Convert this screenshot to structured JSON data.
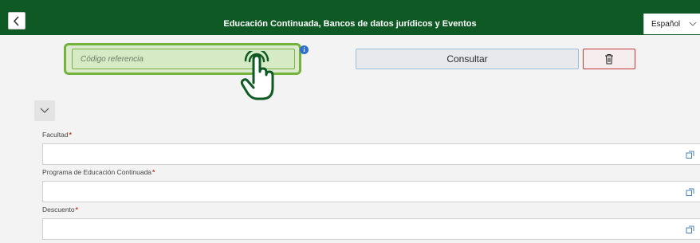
{
  "header": {
    "title": "Educación Continuada, Bancos de datos jurídicos y Eventos",
    "language": "Español",
    "background_color": "#0f5a24"
  },
  "search": {
    "placeholder": "Código referencia",
    "consult_label": "Consultar"
  },
  "fields": [
    {
      "label": "Facultad",
      "required": "*",
      "value": ""
    },
    {
      "label": "Programa de Educación Continuada",
      "required": "*",
      "value": ""
    },
    {
      "label": "Descuento",
      "required": "*",
      "value": ""
    }
  ],
  "icons": {
    "back": "chevron-left-icon",
    "language_dropdown": "chevron-down-icon",
    "info": "info-icon",
    "pointer": "hand-pointer-icon",
    "delete": "trash-icon",
    "collapse": "chevron-down-icon",
    "value_help": "value-help-icon"
  },
  "colors": {
    "highlight": "#73b33c",
    "delete_border": "#c43a3a",
    "required": "#c0392b"
  }
}
